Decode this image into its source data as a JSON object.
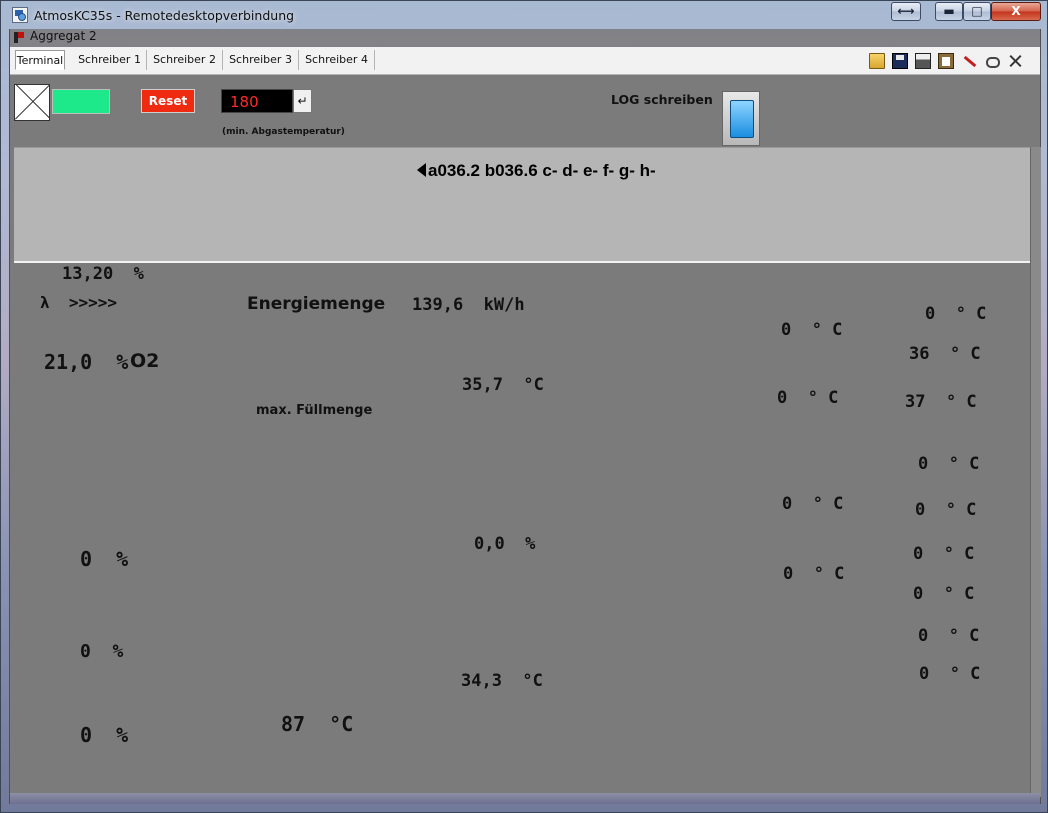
{
  "window": {
    "title": "AtmosKC35s - Remotedesktopverbindung",
    "resize_glyph": "⟷",
    "min_glyph": "▬",
    "max_glyph": "□",
    "close_glyph": "X"
  },
  "document": {
    "title": "Aggregat 2"
  },
  "tabs": [
    "Terminal",
    "Schreiber 1",
    "Schreiber 2",
    "Schreiber 3",
    "Schreiber 4"
  ],
  "toolbar_icons": [
    "open-folder-icon",
    "save-icon",
    "print-icon",
    "clipboard-icon",
    "pen-icon",
    "link-icon",
    "tools-icon"
  ],
  "controls": {
    "reset_label": "Reset",
    "temp_value": "180",
    "enter_glyph": "↵",
    "temp_caption": "(min. Abgastemperatur)",
    "log_label": "LOG schreiben"
  },
  "terminal": {
    "line": "a036.2 b036.6 c- d- e- f- g- h-"
  },
  "readings": {
    "o2_percent": "13,20  %",
    "lambda": "λ  >>>>>",
    "o2_total": "21,0  %",
    "o2_unit": "O2",
    "energy_label": "Energiemenge",
    "energy_value": "139,6  kW/h",
    "max_fill_label": "max. Füllmenge",
    "temp_1": "35,7  °C",
    "percent_1": "0,0  %",
    "temp_2": "34,3  °C",
    "temp_3": "87  °C",
    "left_pct_1": "0  %",
    "left_pct_2": "0  %",
    "left_pct_3": "0  %",
    "mid_col": [
      "0  ° C",
      "0  ° C",
      "0  ° C",
      "0  ° C"
    ],
    "right_col": [
      "0  ° C",
      "36  ° C",
      "37  ° C",
      "0  ° C",
      "0  ° C",
      "0  ° C",
      "0  ° C",
      "0  ° C",
      "0  ° C"
    ]
  }
}
